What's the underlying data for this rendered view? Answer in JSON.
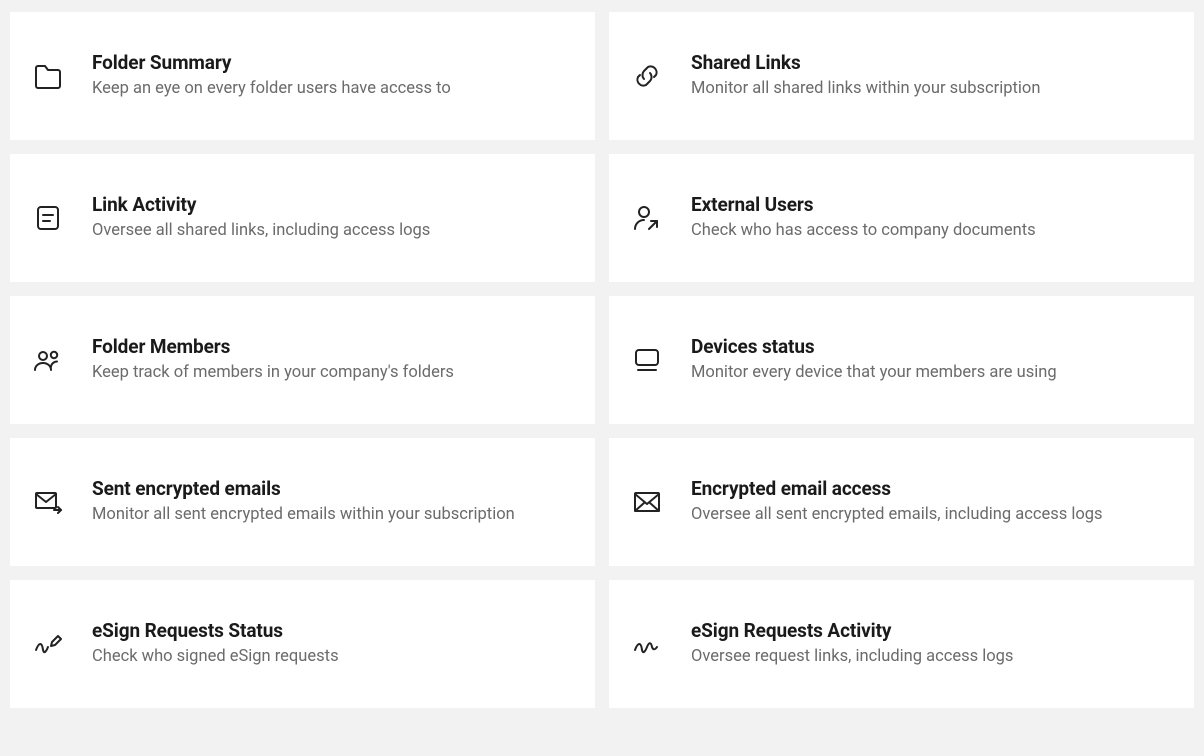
{
  "cards": [
    {
      "title": "Folder Summary",
      "desc": "Keep an eye on every folder users have access to"
    },
    {
      "title": "Shared Links",
      "desc": "Monitor all shared links within your subscription"
    },
    {
      "title": "Link Activity",
      "desc": "Oversee all shared links, including access logs"
    },
    {
      "title": "External Users",
      "desc": "Check who has access to company documents"
    },
    {
      "title": "Folder Members",
      "desc": "Keep track of members in your company's folders"
    },
    {
      "title": "Devices status",
      "desc": "Monitor every device that your members are using"
    },
    {
      "title": "Sent encrypted emails",
      "desc": "Monitor all sent encrypted emails within your subscription"
    },
    {
      "title": "Encrypted email access",
      "desc": "Oversee all sent encrypted emails, including access logs"
    },
    {
      "title": "eSign Requests Status",
      "desc": "Check who signed eSign requests"
    },
    {
      "title": "eSign Requests Activity",
      "desc": "Oversee request links, including access logs"
    }
  ]
}
